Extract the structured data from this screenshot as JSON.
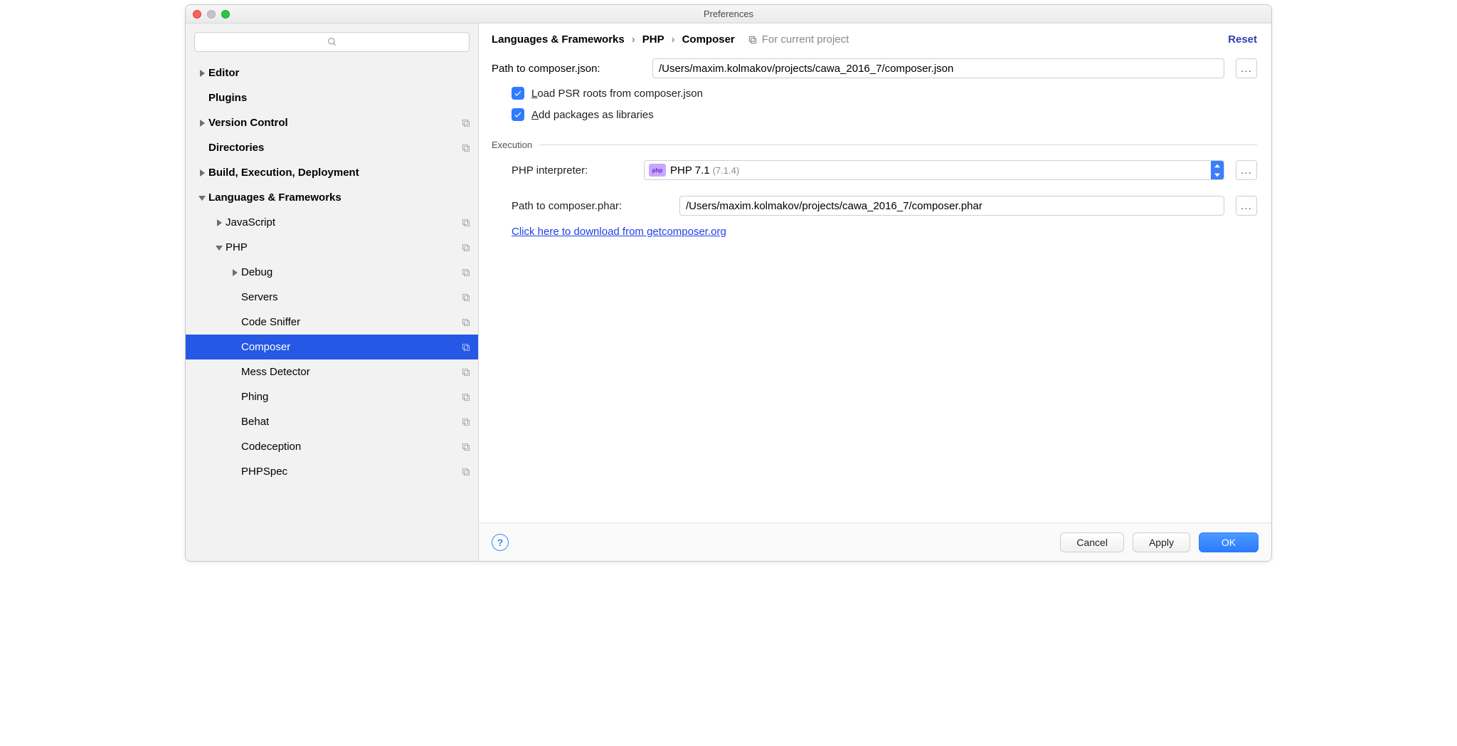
{
  "window": {
    "title": "Preferences"
  },
  "sidebar": {
    "items": [
      {
        "label": "Editor",
        "bold": true,
        "arrow": "right",
        "indent": 0,
        "copy": false
      },
      {
        "label": "Plugins",
        "bold": true,
        "arrow": "none",
        "indent": 0,
        "copy": false
      },
      {
        "label": "Version Control",
        "bold": true,
        "arrow": "right",
        "indent": 0,
        "copy": true
      },
      {
        "label": "Directories",
        "bold": true,
        "arrow": "none",
        "indent": 0,
        "copy": true
      },
      {
        "label": "Build, Execution, Deployment",
        "bold": true,
        "arrow": "right",
        "indent": 0,
        "copy": false
      },
      {
        "label": "Languages & Frameworks",
        "bold": true,
        "arrow": "down",
        "indent": 0,
        "copy": false
      },
      {
        "label": "JavaScript",
        "bold": false,
        "arrow": "right",
        "indent": 1,
        "copy": true
      },
      {
        "label": "PHP",
        "bold": false,
        "arrow": "down",
        "indent": 1,
        "copy": true
      },
      {
        "label": "Debug",
        "bold": false,
        "arrow": "right",
        "indent": 2,
        "copy": true
      },
      {
        "label": "Servers",
        "bold": false,
        "arrow": "none",
        "indent": 2,
        "copy": true
      },
      {
        "label": "Code Sniffer",
        "bold": false,
        "arrow": "none",
        "indent": 2,
        "copy": true
      },
      {
        "label": "Composer",
        "bold": false,
        "arrow": "none",
        "indent": 2,
        "copy": true,
        "selected": true
      },
      {
        "label": "Mess Detector",
        "bold": false,
        "arrow": "none",
        "indent": 2,
        "copy": true
      },
      {
        "label": "Phing",
        "bold": false,
        "arrow": "none",
        "indent": 2,
        "copy": true
      },
      {
        "label": "Behat",
        "bold": false,
        "arrow": "none",
        "indent": 2,
        "copy": true
      },
      {
        "label": "Codeception",
        "bold": false,
        "arrow": "none",
        "indent": 2,
        "copy": true
      },
      {
        "label": "PHPSpec",
        "bold": false,
        "arrow": "none",
        "indent": 2,
        "copy": true
      }
    ]
  },
  "header": {
    "crumb1": "Languages & Frameworks",
    "crumb2": "PHP",
    "crumb3": "Composer",
    "scope": "For current project",
    "reset": "Reset"
  },
  "form": {
    "composer_json_label": "Path to composer.json:",
    "composer_json_value": "/Users/maxim.kolmakov/projects/cawa_2016_7/composer.json",
    "load_psr_label_pre": "L",
    "load_psr_label_rest": "oad PSR roots from composer.json",
    "add_pkg_label_pre": "A",
    "add_pkg_label_rest": "dd packages as libraries",
    "execution_title": "Execution",
    "interp_label": "PHP interpreter:",
    "interp_value": "PHP 7.1",
    "interp_version": "(7.1.4)",
    "phpicon_text": "php",
    "phar_label": "Path to composer.phar:",
    "phar_value": "/Users/maxim.kolmakov/projects/cawa_2016_7/composer.phar",
    "download_link": "Click here to download from getcomposer.org"
  },
  "footer": {
    "cancel": "Cancel",
    "apply": "Apply",
    "ok": "OK"
  }
}
